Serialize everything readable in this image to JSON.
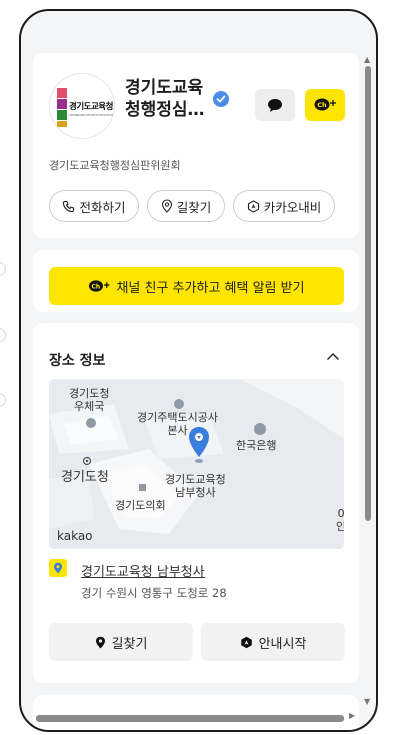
{
  "profile": {
    "name": "경기도교육청행정심판위원회",
    "name_display": "경기도교육\n청행정심…",
    "description": "경기도교육청행정심판위원회",
    "logo_text": "경기도교육청",
    "logo_side_text": "행정심판",
    "logo_sub_text": "GYEONGGIDO OFFICE OF EDUCATION"
  },
  "actions": {
    "call_label": "전화하기",
    "route_label": "길찾기",
    "navi_label": "카카오내비"
  },
  "channel": {
    "add_label": "채널 친구 추가하고 혜택 알림 받기"
  },
  "place": {
    "section_title": "장소 정보",
    "map_labels": {
      "gyeonggi_post": "경기도청\n우체국",
      "housing": "경기주택도시공사\n본사",
      "bank": "한국은행",
      "office": "경기도교육청\n남부청사",
      "provincial_office": "경기도청",
      "council": "경기도의회",
      "edge_text": "0\n인"
    },
    "map_brand": "kakao",
    "address_name": "경기도교육청 남부청사",
    "address_line": "경기 수원시 영통구 도청로 28",
    "route_button": "길찾기",
    "guide_button": "안내시작"
  },
  "colors": {
    "accent_yellow": "#fee500",
    "verified_blue": "#4b8ce8",
    "map_pin": "#3b7ddd"
  }
}
